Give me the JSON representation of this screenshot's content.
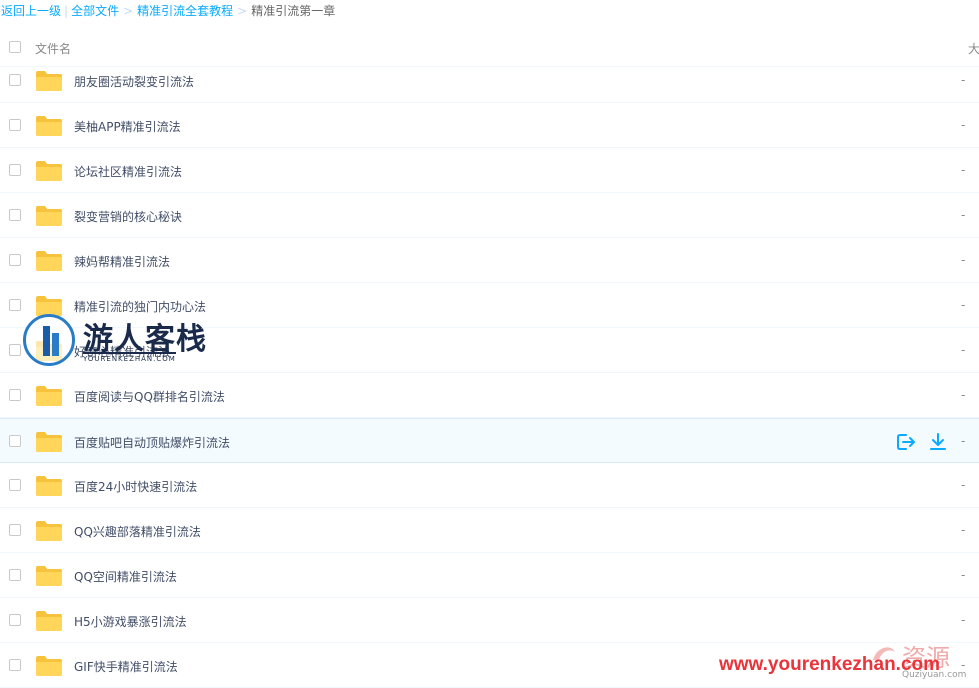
{
  "breadcrumb": {
    "back": "返回上一级",
    "all_files": "全部文件",
    "parent": "精准引流全套教程",
    "current": "精准引流第一章"
  },
  "header": {
    "name_col": "文件名",
    "size_col": "大"
  },
  "rows": [
    {
      "name": "朋友圈活动裂变引流法",
      "size": "-"
    },
    {
      "name": "美柚APP精准引流法",
      "size": "-"
    },
    {
      "name": "论坛社区精准引流法",
      "size": "-"
    },
    {
      "name": "裂变营销的核心秘诀",
      "size": "-"
    },
    {
      "name": "辣妈帮精准引流法",
      "size": "-"
    },
    {
      "name": "精准引流的独门内功心法",
      "size": "-"
    },
    {
      "name": "好奇心精准引流法",
      "size": "-"
    },
    {
      "name": "百度阅读与QQ群排名引流法",
      "size": "-"
    },
    {
      "name": "百度贴吧自动顶贴爆炸引流法",
      "size": "-"
    },
    {
      "name": "百度24小时快速引流法",
      "size": "-"
    },
    {
      "name": "QQ兴趣部落精准引流法",
      "size": "-"
    },
    {
      "name": "QQ空间精准引流法",
      "size": "-"
    },
    {
      "name": "H5小游戏暴涨引流法",
      "size": "-"
    },
    {
      "name": "GIF快手精准引流法",
      "size": "-"
    }
  ],
  "hovered_row": 8,
  "row_actions": {
    "share_icon": "share-export-icon",
    "download_icon": "download-icon"
  },
  "colors": {
    "link": "#09aaff",
    "folder": "#ffd04b",
    "hover_bg": "#f4fbff",
    "action_icon": "#09aaff"
  },
  "watermarks": {
    "top_title": "游人客栈",
    "top_sub": "YOURENKEZHAN.COM",
    "bottom_url": "www.yourenkezhan.com",
    "bottom_cn": "资源",
    "bottom_small": "Quziyuan.com"
  }
}
